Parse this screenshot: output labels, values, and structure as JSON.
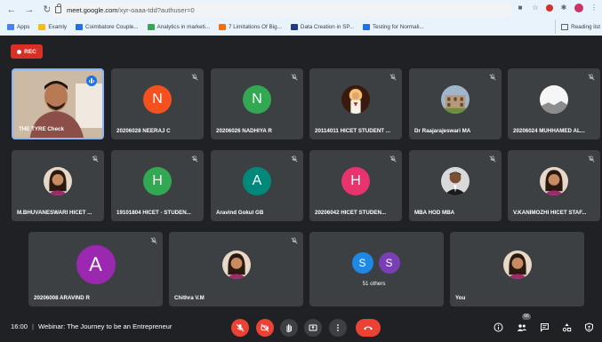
{
  "browser": {
    "url_host": "meet.google.com",
    "url_path": "/xyr-oaaa-tdd?authuser=0",
    "bookmarks": [
      {
        "label": "Apps",
        "color": "#4285f4"
      },
      {
        "label": "Examly",
        "color": "#fbbc04"
      },
      {
        "label": "Coimbatore Couple...",
        "color": "#1a73e8"
      },
      {
        "label": "Analytics in marketi...",
        "color": "#34a853"
      },
      {
        "label": "7 Limitations Of Big...",
        "color": "#ff6d00"
      },
      {
        "label": "Data Creation in SP...",
        "color": "#1f3a93"
      },
      {
        "label": "Testing for Normali...",
        "color": "#1a73e8"
      }
    ],
    "reading_list": "Reading list"
  },
  "recording_label": "REC",
  "participants": [
    {
      "name": "THE TYRE Check",
      "type": "video",
      "speaking": true
    },
    {
      "name": "20206028 NEERAJ C",
      "initial": "N",
      "color": "#f4511e"
    },
    {
      "name": "20206026 NADHIYA R",
      "initial": "N",
      "color": "#33a852"
    },
    {
      "name": "20114011 HICET STUDENT ...",
      "type": "photo",
      "icon": "religious-image-photo"
    },
    {
      "name": "Dr Raajarajeswari MA",
      "type": "photo",
      "icon": "building-photo"
    },
    {
      "name": "20206024 MUHHAMED AL...",
      "type": "photo",
      "icon": "white-shape-photo"
    },
    {
      "name": "M.BHUVANESWARI HICET ...",
      "type": "photo",
      "icon": "woman-photo"
    },
    {
      "name": "19101804 HICET - STUDEN...",
      "initial": "H",
      "color": "#33a852"
    },
    {
      "name": "Aravind Gokul GB",
      "initial": "A",
      "color": "#00897b"
    },
    {
      "name": "20206042 HICET STUDEN...",
      "initial": "H",
      "color": "#e8336e"
    },
    {
      "name": "MBA HOD MBA",
      "type": "photo",
      "icon": "man-photo"
    },
    {
      "name": "V.KANIMOZHI HICET STAF...",
      "type": "photo",
      "icon": "woman-photo"
    },
    {
      "name": "20206008 ARAVIND R",
      "initial": "A",
      "color": "#9c27b0"
    },
    {
      "name": "Chithra V.M",
      "type": "photo",
      "icon": "woman-photo"
    },
    {
      "name": "51 others",
      "type": "others",
      "initials": [
        "S",
        "S"
      ],
      "colors": [
        "#1e88e5",
        "#7b3fb5"
      ]
    },
    {
      "name": "You",
      "type": "photo",
      "icon": "woman-photo"
    }
  ],
  "bottom_bar": {
    "time": "16:00",
    "meeting_title": "Webinar: The Journey to be an Entrepreneur",
    "participant_count": "66"
  }
}
